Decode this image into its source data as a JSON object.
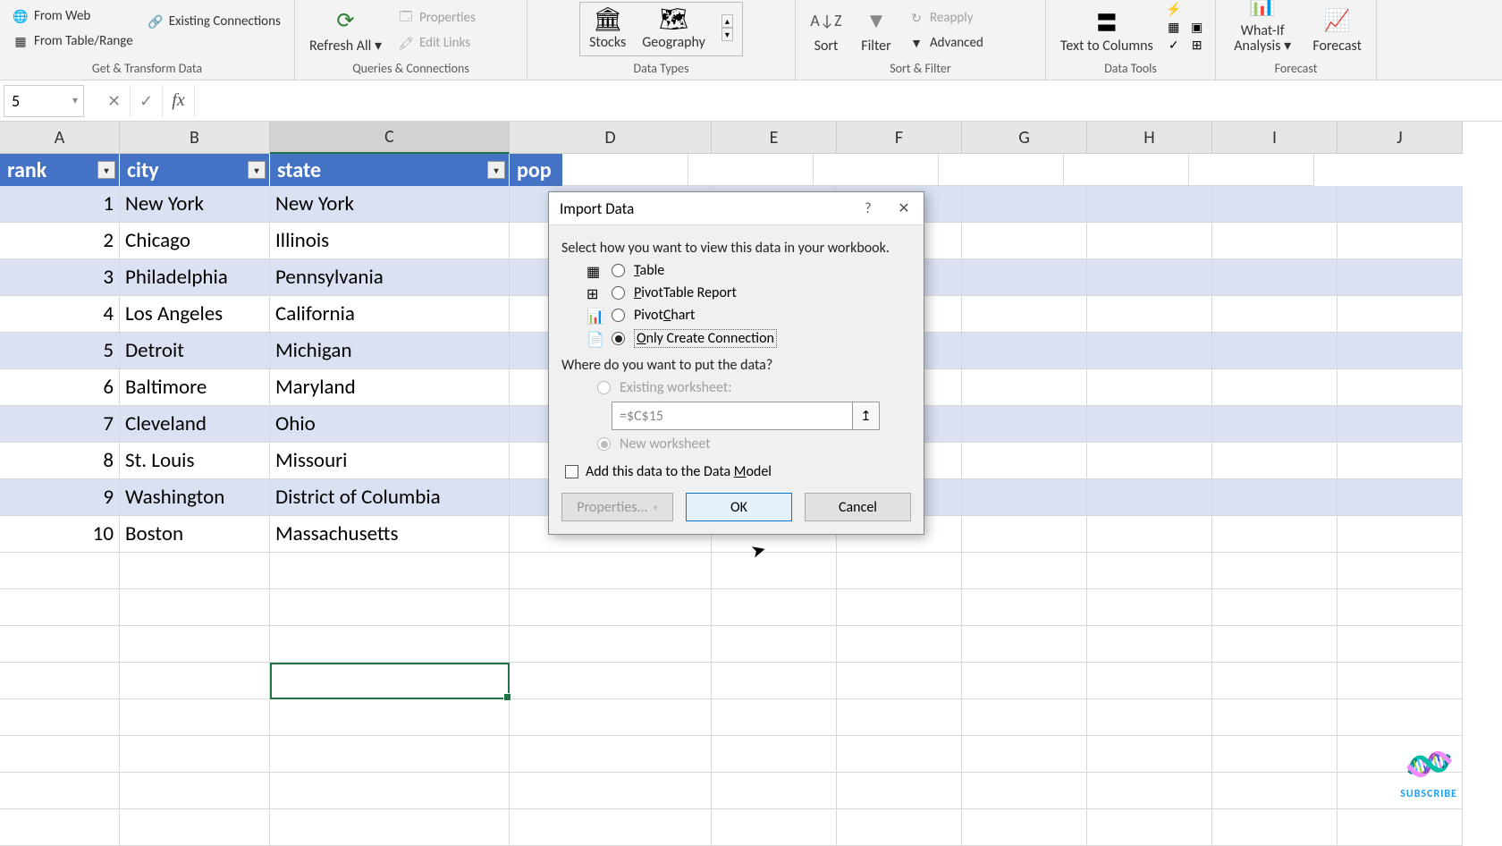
{
  "ribbon": {
    "from_web": "From Web",
    "existing_conn": "Existing Connections",
    "from_table": "From Table/Range",
    "group_get": "Get & Transform Data",
    "refresh": "Refresh All",
    "properties": "Properties",
    "edit_links": "Edit Links",
    "group_queries": "Queries & Connections",
    "stocks": "Stocks",
    "geography": "Geography",
    "group_types": "Data Types",
    "sort": "Sort",
    "filter": "Filter",
    "reapply": "Reapply",
    "advanced": "Advanced",
    "group_sort": "Sort & Filter",
    "text_cols": "Text to Columns",
    "group_tools": "Data Tools",
    "whatif": "What-If Analysis",
    "forecast": "Forecast",
    "group_forecast": "Forecast"
  },
  "name_box": "5",
  "columns": [
    "A",
    "B",
    "C",
    "D",
    "E",
    "F",
    "G",
    "H",
    "I",
    "J"
  ],
  "table": {
    "headers": [
      "rank",
      "city",
      "state",
      "pop"
    ],
    "rows": [
      {
        "rank": "1",
        "city": "New York",
        "state": "New York"
      },
      {
        "rank": "2",
        "city": "Chicago",
        "state": "Illinois"
      },
      {
        "rank": "3",
        "city": "Philadelphia",
        "state": "Pennsylvania"
      },
      {
        "rank": "4",
        "city": "Los Angeles",
        "state": "California"
      },
      {
        "rank": "5",
        "city": "Detroit",
        "state": "Michigan"
      },
      {
        "rank": "6",
        "city": "Baltimore",
        "state": "Maryland"
      },
      {
        "rank": "7",
        "city": "Cleveland",
        "state": "Ohio"
      },
      {
        "rank": "8",
        "city": "St. Louis",
        "state": "Missouri"
      },
      {
        "rank": "9",
        "city": "Washington",
        "state": "District of Columbia"
      },
      {
        "rank": "10",
        "city": "Boston",
        "state": "Massachusetts"
      }
    ]
  },
  "dialog": {
    "title": "Import Data",
    "prompt1": "Select how you want to view this data in your workbook.",
    "opt_table": "Table",
    "opt_pivot": "PivotTable Report",
    "opt_chart": "PivotChart",
    "opt_conn": "Only Create Connection",
    "prompt2": "Where do you want to put the data?",
    "opt_existing": "Existing worksheet:",
    "ref_value": "=$C$15",
    "opt_new": "New worksheet",
    "add_model": "Add this data to the Data Model",
    "btn_props": "Properties...",
    "btn_ok": "OK",
    "btn_cancel": "Cancel"
  },
  "subscribe": "SUBSCRIBE"
}
